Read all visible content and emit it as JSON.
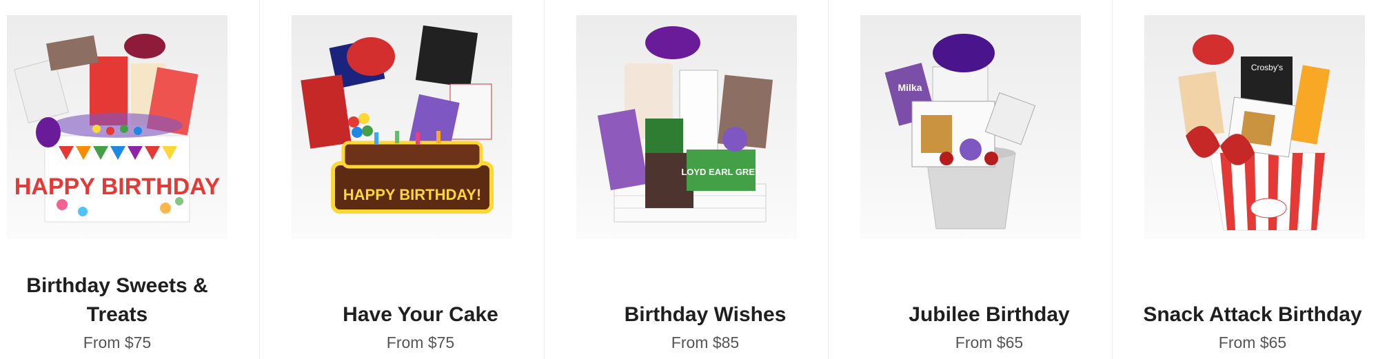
{
  "products": [
    {
      "name": "Birthday Sweets & Treats",
      "price": "From $75",
      "container_text": "HAPPY BIRTHDAY"
    },
    {
      "name": "Have Your Cake",
      "price": "From $75",
      "container_text": "HAPPY BIRTHDAY!"
    },
    {
      "name": "Birthday Wishes",
      "price": "From $85",
      "container_text": "LOYD EARL GREY"
    },
    {
      "name": "Jubilee Birthday",
      "price": "From $65",
      "container_text": "Milka"
    },
    {
      "name": "Snack Attack Birthday",
      "price": "From $65",
      "container_text": "Crosby's"
    }
  ],
  "colors": {
    "title": "#1f1f1f",
    "price": "#555555",
    "divider": "#ececec"
  }
}
